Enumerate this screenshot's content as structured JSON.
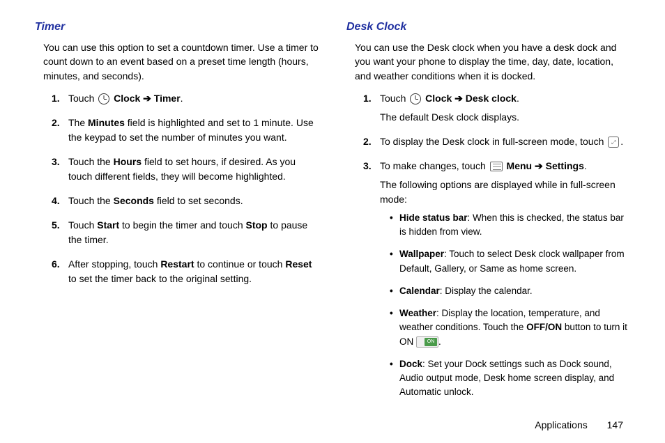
{
  "left": {
    "title": "Timer",
    "intro": "You can use this option to set a countdown timer. Use a timer to count down to an event based on a preset time length (hours, minutes, and seconds).",
    "steps": {
      "s1_pre": "Touch ",
      "s1_clock": "Clock",
      "s1_arrow": " ➔ ",
      "s1_timer": "Timer",
      "s1_end": ".",
      "s2_a": "The ",
      "s2_b": "Minutes",
      "s2_c": " field is highlighted and set to 1 minute. Use the keypad to set the number of minutes you want.",
      "s3_a": "Touch the ",
      "s3_b": "Hours",
      "s3_c": " field to set hours, if desired. As you touch different fields, they will become highlighted.",
      "s4_a": "Touch the ",
      "s4_b": "Seconds",
      "s4_c": " field to set seconds.",
      "s5_a": "Touch ",
      "s5_b": "Start",
      "s5_c": " to begin the timer and touch ",
      "s5_d": "Stop",
      "s5_e": " to pause the timer.",
      "s6_a": "After stopping, touch ",
      "s6_b": "Restart",
      "s6_c": " to continue or touch ",
      "s6_d": "Reset",
      "s6_e": " to set the timer back to the original setting."
    },
    "nums": {
      "n1": "1.",
      "n2": "2.",
      "n3": "3.",
      "n4": "4.",
      "n5": "5.",
      "n6": "6."
    }
  },
  "right": {
    "title": "Desk Clock",
    "intro": "You can use the Desk clock when you have a desk dock and you want your phone to display the time, day, date, location, and weather conditions when it is docked.",
    "steps": {
      "s1_pre": "Touch ",
      "s1_clock": "Clock",
      "s1_arrow": " ➔ ",
      "s1_desk": "Desk clock",
      "s1_end": ".",
      "s1_sub": "The default Desk clock displays.",
      "s2_a": "To display the Desk clock in full-screen mode, touch ",
      "s2_end": ".",
      "s3_a": "To make changes, touch ",
      "s3_menu": "Menu",
      "s3_arrow": " ➔ ",
      "s3_settings": "Settings",
      "s3_end": ".",
      "s3_sub": "The following options are displayed while in full-screen mode:"
    },
    "nums": {
      "n1": "1.",
      "n2": "2.",
      "n3": "3."
    },
    "bullets": {
      "b1_t": "Hide status bar",
      "b1_d": ": When this is checked, the status bar is hidden from view.",
      "b2_t": "Wallpaper",
      "b2_d": ": Touch to select Desk clock wallpaper from Default, Gallery, or Same as home screen.",
      "b3_t": "Calendar",
      "b3_d": ": Display the calendar.",
      "b4_t": "Weather",
      "b4_d1": ": Display the location, temperature, and weather conditions. Touch the ",
      "b4_offon": "OFF/ON",
      "b4_d2": " button to turn it ON ",
      "b4_end": ".",
      "b5_t": "Dock",
      "b5_d": ": Set your Dock settings such as Dock sound, Audio output mode, Desk home screen display, and Automatic unlock."
    }
  },
  "footer": {
    "section": "Applications",
    "page": "147"
  }
}
